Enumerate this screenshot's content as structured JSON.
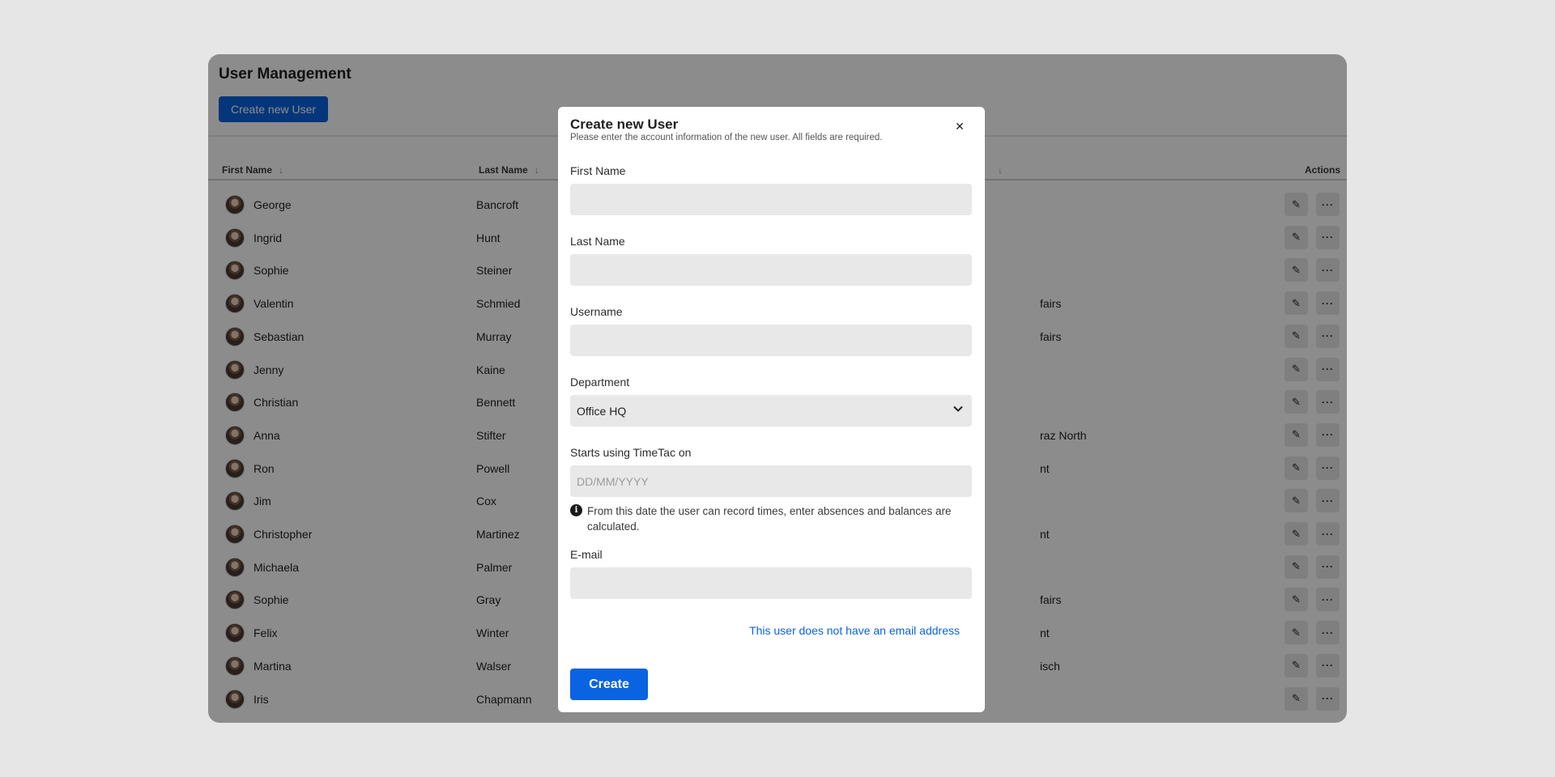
{
  "page": {
    "title": "User Management",
    "create_button": "Create new User"
  },
  "table": {
    "columns": {
      "first_name": "First Name",
      "last_name": "Last Name",
      "actions": "Actions"
    },
    "rows": [
      {
        "first": "George",
        "last": "Bancroft",
        "dept": ""
      },
      {
        "first": "Ingrid",
        "last": "Hunt",
        "dept": ""
      },
      {
        "first": "Sophie",
        "last": "Steiner",
        "dept": ""
      },
      {
        "first": "Valentin",
        "last": "Schmied",
        "dept": "fairs"
      },
      {
        "first": "Sebastian",
        "last": "Murray",
        "dept": "fairs"
      },
      {
        "first": "Jenny",
        "last": "Kaine",
        "dept": ""
      },
      {
        "first": "Christian",
        "last": "Bennett",
        "dept": ""
      },
      {
        "first": "Anna",
        "last": "Stifter",
        "dept": "raz North"
      },
      {
        "first": "Ron",
        "last": "Powell",
        "dept": "nt"
      },
      {
        "first": "Jim",
        "last": "Cox",
        "dept": ""
      },
      {
        "first": "Christopher",
        "last": "Martinez",
        "dept": "nt"
      },
      {
        "first": "Michaela",
        "last": "Palmer",
        "dept": ""
      },
      {
        "first": "Sophie",
        "last": "Gray",
        "dept": "fairs"
      },
      {
        "first": "Felix",
        "last": "Winter",
        "dept": "nt"
      },
      {
        "first": "Martina",
        "last": "Walser",
        "dept": "isch"
      },
      {
        "first": "Iris",
        "last": "Chapmann",
        "dept": ""
      }
    ]
  },
  "modal": {
    "title": "Create new User",
    "subtitle": "Please enter the account information of the new user. All fields are required.",
    "close_icon": "close-icon",
    "first_name_label": "First Name",
    "first_name_value": "",
    "last_name_label": "Last Name",
    "last_name_value": "",
    "username_label": "Username",
    "username_value": "",
    "department_label": "Department",
    "department_value": "Office HQ",
    "start_label": "Starts using TimeTac on",
    "start_placeholder": "DD/MM/YYYY",
    "info_text": "From this date the user can record times, enter absences and balances are calculated.",
    "email_label": "E-mail",
    "email_value": "",
    "no_email_link": "This user does not have an email address",
    "submit": "Create"
  },
  "colors": {
    "primary": "#0a63e0",
    "background": "#e6e6e6",
    "overlay": "rgba(0,0,0,0.45)",
    "field": "#e8e8e8"
  }
}
